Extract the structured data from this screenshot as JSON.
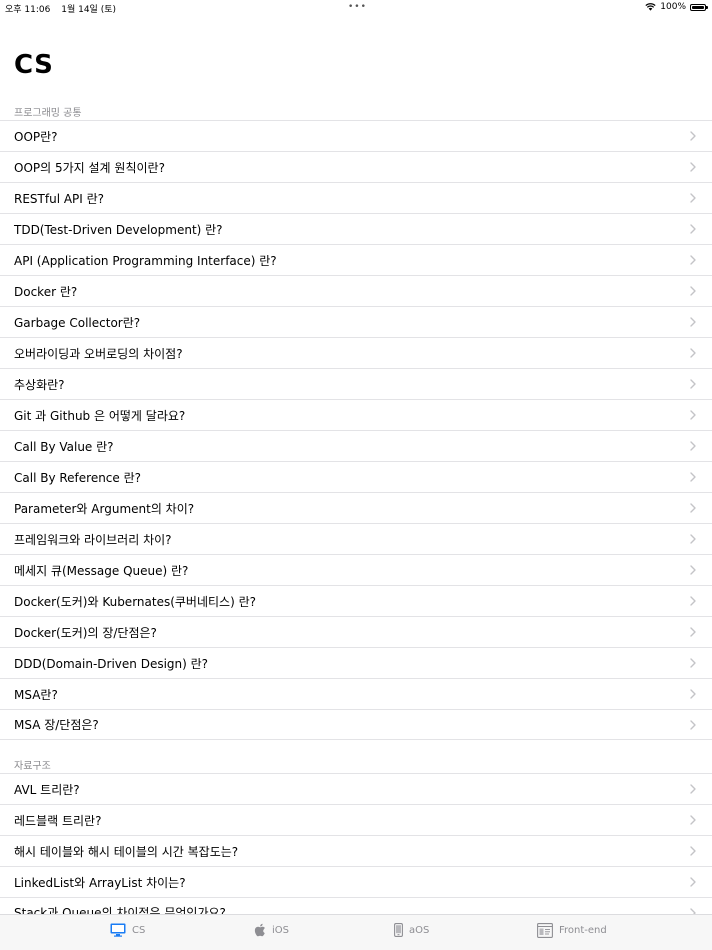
{
  "status_bar": {
    "time": "오후 11:06",
    "date": "1월 14일 (토)",
    "battery": "100%"
  },
  "page_title": "CS",
  "sections": [
    {
      "header": "프로그래밍 공통",
      "items": [
        "OOP란?",
        "OOP의 5가지 설계 원칙이란?",
        "RESTful API 란?",
        "TDD(Test-Driven Development) 란?",
        "API (Application Programming Interface) 란?",
        "Docker 란?",
        "Garbage Collector란?",
        "오버라이딩과 오버로딩의 차이점?",
        "추상화란?",
        "Git 과 Github 은 어떻게 달라요?",
        "Call By Value 란?",
        "Call By Reference 란?",
        "Parameter와 Argument의 차이?",
        "프레임워크와 라이브러리 차이?",
        "메세지 큐(Message Queue) 란?",
        "Docker(도커)와 Kubernates(쿠버네티스) 란?",
        "Docker(도커)의 장/단점은?",
        "DDD(Domain-Driven Design) 란?",
        "MSA란?",
        "MSA 장/단점은?"
      ]
    },
    {
      "header": "자료구조",
      "items": [
        "AVL 트리란?",
        "레드블랙 트리란?",
        "해시 테이블와 해시 테이블의 시간 복잡도는?",
        "LinkedList와 ArrayList 차이는?",
        "Stack과 Queue의 차이점은 무엇인가요?"
      ]
    }
  ],
  "tabs": [
    {
      "label": "CS",
      "icon": "desktop-icon",
      "selected": true
    },
    {
      "label": "iOS",
      "icon": "apple-icon",
      "selected": false
    },
    {
      "label": "aOS",
      "icon": "phone-icon",
      "selected": false
    },
    {
      "label": "Front-end",
      "icon": "browser-window-icon",
      "selected": false
    }
  ],
  "colors": {
    "accent": "#1a7cf4",
    "inactive_tab": "#8e8e93",
    "section_header": "#8a8a8e",
    "separator": "#e3e3e6"
  }
}
